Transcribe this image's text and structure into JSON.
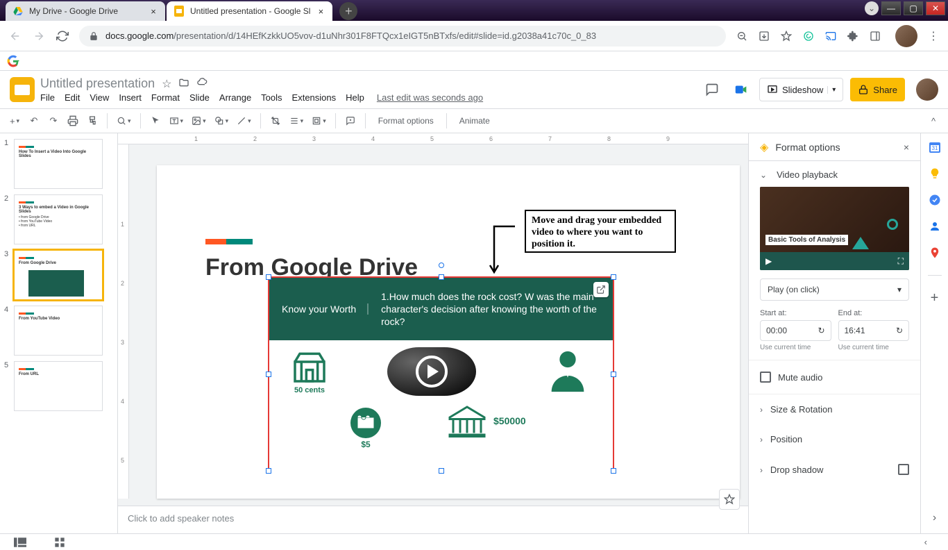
{
  "browser": {
    "tabs": [
      {
        "title": "My Drive - Google Drive",
        "favicon": "drive"
      },
      {
        "title": "Untitled presentation - Google Sl",
        "favicon": "slides",
        "active": true
      }
    ],
    "url_host": "docs.google.com",
    "url_path": "/presentation/d/14HEfKzkkUO5vov-d1uNhr301F8FTQcx1eIGT5nBTxfs/edit#slide=id.g2038a41c70c_0_83"
  },
  "docs": {
    "title": "Untitled presentation",
    "menus": [
      "File",
      "Edit",
      "View",
      "Insert",
      "Format",
      "Slide",
      "Arrange",
      "Tools",
      "Extensions",
      "Help"
    ],
    "last_edit": "Last edit was seconds ago",
    "slideshow_label": "Slideshow",
    "share_label": "Share"
  },
  "toolbar": {
    "format_options": "Format options",
    "animate": "Animate"
  },
  "ruler_marks": [
    1,
    2,
    3,
    4,
    5,
    6,
    7,
    8,
    9
  ],
  "ruler_v": [
    1,
    2,
    3,
    4,
    5
  ],
  "filmstrip": [
    {
      "num": "1",
      "title": "How To Insert a Video Into Google Slides"
    },
    {
      "num": "2",
      "title": "3 Ways to embed a Video in Google Slides"
    },
    {
      "num": "3",
      "title": "From Google Drive",
      "selected": true
    },
    {
      "num": "4",
      "title": "From YouTube Video"
    },
    {
      "num": "5",
      "title": "From URL"
    }
  ],
  "slide": {
    "title": "From Google Drive",
    "annotation": "Move and drag your embedded video to where you want to position it.",
    "video": {
      "kyw": "Know your Worth",
      "question": "1.How much does the rock cost? W was the main character's decision after knowing the worth of the rock?",
      "price1": "50 cents",
      "price2": "$5",
      "price3": "$50000"
    }
  },
  "notes": {
    "placeholder": "Click to add speaker notes"
  },
  "format_panel": {
    "title": "Format options",
    "section_video": "Video playback",
    "preview_title": "Basic Tools of Analysis",
    "play_mode": "Play (on click)",
    "start_label": "Start at:",
    "end_label": "End at:",
    "start_val": "00:00",
    "end_val": "16:41",
    "use_current": "Use current time",
    "mute": "Mute audio",
    "size_rot": "Size & Rotation",
    "position": "Position",
    "drop_shadow": "Drop shadow"
  }
}
